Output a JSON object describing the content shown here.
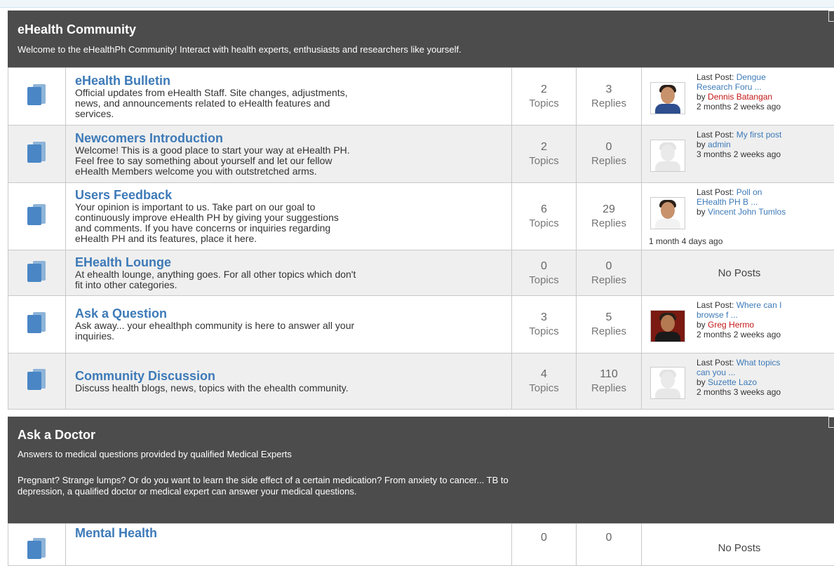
{
  "categories": [
    {
      "title": "eHealth Community",
      "description": "Welcome to the eHealthPh Community! Interact with health experts, enthusiasts and researchers like yourself.",
      "forums": [
        {
          "title": "eHealth Bulletin",
          "description_lines": [
            "Official updates from eHealth Staff. Site changes, adjustments,",
            "news, and announcements related to eHealth features and",
            "services."
          ],
          "topics": "2",
          "replies": "3",
          "last_post": {
            "label": "Last Post:",
            "title_lines": [
              "Dengue",
              "Research Foru ..."
            ],
            "by": "by",
            "user": "Dennis Batangan",
            "time": "2 months 2 weeks ago"
          }
        },
        {
          "title": "Newcomers Introduction",
          "description_lines": [
            "Welcome! This is a good place to start your way at eHealth PH.",
            "Feel free to say something about yourself and let our fellow",
            "eHealth Members welcome you with outstretched arms."
          ],
          "topics": "2",
          "replies": "0",
          "last_post": {
            "label": "Last Post:",
            "title_lines": [
              "My first post"
            ],
            "by": "by",
            "user": "admin",
            "time": "3 months 2 weeks ago"
          }
        },
        {
          "title": "Users Feedback",
          "description_lines": [
            "Your opinion is important to us. Take part on our goal to",
            "continuously improve eHealth PH by giving your suggestions",
            "and comments. If you have concerns or inquiries regarding",
            "eHealth PH and its features, place it here."
          ],
          "topics": "6",
          "replies": "29",
          "last_post": {
            "label": "Last Post:",
            "title_lines": [
              "Poll on",
              "EHealth PH B ..."
            ],
            "by": "by",
            "user": "Vincent John Tumlos",
            "time": "1 month 4 days ago"
          }
        },
        {
          "title": "EHealth Lounge",
          "description_lines": [
            "At ehealth lounge, anything goes. For all other topics which don't",
            "fit into other categories."
          ],
          "topics": "0",
          "replies": "0",
          "no_posts": "No Posts"
        },
        {
          "title": "Ask a Question",
          "description_lines": [
            "Ask away... your ehealthph community is here to answer all your",
            "inquiries."
          ],
          "topics": "3",
          "replies": "5",
          "last_post": {
            "label": "Last Post:",
            "title_lines": [
              "Where can I",
              "browse f ..."
            ],
            "by": "by",
            "user": "Greg Hermo",
            "time": "2 months 2 weeks ago"
          }
        },
        {
          "title": "Community Discussion",
          "description_lines": [
            "Discuss health blogs, news, topics with the ehealth community."
          ],
          "topics": "4",
          "replies": "110",
          "last_post": {
            "label": "Last Post:",
            "title_lines": [
              "What topics",
              "can you ..."
            ],
            "by": "by",
            "user": "Suzette Lazo",
            "time": "2 months 3 weeks ago"
          }
        }
      ]
    },
    {
      "title": "Ask a Doctor",
      "description": "Answers to medical questions provided by qualified Medical Experts",
      "description2_lines": [
        "Pregnant? Strange lumps? Or do you want to learn the side effect of a certain medication? From anxiety to cancer... TB to",
        "depression, a qualified doctor or medical expert can answer your medical questions."
      ],
      "forums": [
        {
          "title": "Mental Health",
          "topics": "0",
          "replies": "0",
          "no_posts": "No Posts"
        }
      ]
    }
  ],
  "labels": {
    "topics": "Topics",
    "replies": "Replies"
  }
}
